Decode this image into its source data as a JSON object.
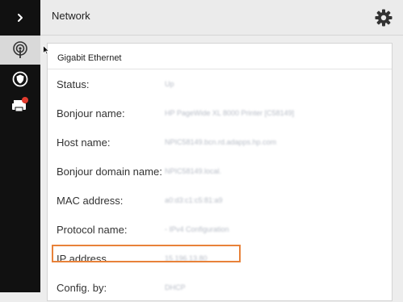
{
  "header": {
    "title": "Network"
  },
  "sidebar": {
    "toggle_icon": "chevron-right-icon",
    "items": [
      {
        "icon": "wireless-antenna-icon",
        "active": true
      },
      {
        "icon": "shield-icon",
        "active": false
      },
      {
        "icon": "printer-alert-icon",
        "active": false
      }
    ]
  },
  "panel": {
    "title": "Gigabit Ethernet",
    "rows": [
      {
        "label": "Status:",
        "value": "Up"
      },
      {
        "label": "Bonjour name:",
        "value": "HP PageWide XL 8000 Printer [C58149]"
      },
      {
        "label": "Host name:",
        "value": "NPIC58149.bcn.rd.adapps.hp.com"
      },
      {
        "label": "Bonjour domain name:",
        "value": "NPIC58149.local."
      },
      {
        "label": "MAC address:",
        "value": "a0:d3:c1:c5:81:a9"
      },
      {
        "label": "Protocol name:",
        "value": "- IPv4 Configuration"
      },
      {
        "label": "IP address",
        "value": "15.196.13.80",
        "highlighted": true
      },
      {
        "label": "Config. by:",
        "value": "DHCP"
      }
    ]
  },
  "colors": {
    "highlight": "#e8823a",
    "rail": "#111111",
    "active_item": "#d9d9d9"
  }
}
